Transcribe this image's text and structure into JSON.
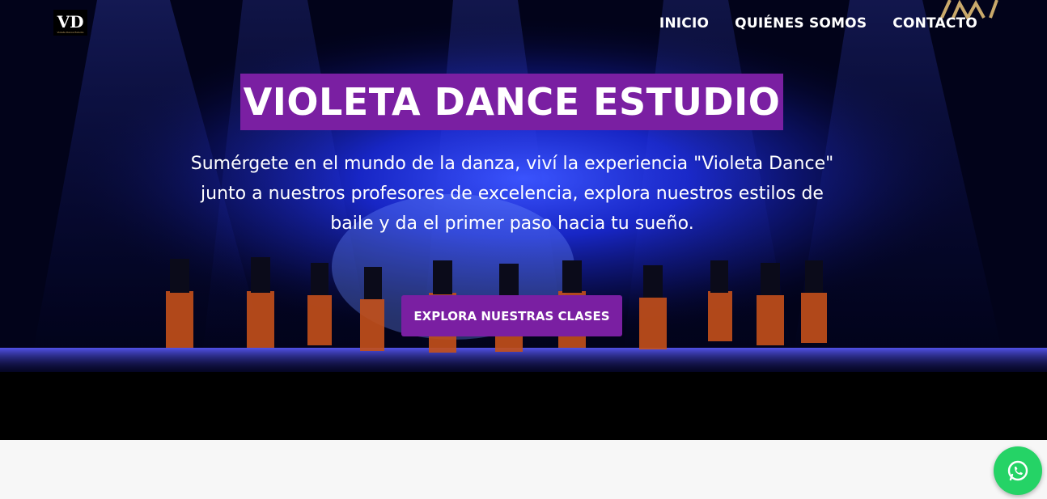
{
  "brand": {
    "logo_text": "VD",
    "logo_tagline": "Violeta Dance Estudio"
  },
  "nav": {
    "items": [
      {
        "label": "INICIO"
      },
      {
        "label": "QUIÉNES SOMOS"
      },
      {
        "label": "CONTACTO"
      }
    ]
  },
  "hero": {
    "title": "VIOLETA DANCE ESTUDIO",
    "subtitle": "Sumérgete en el mundo de la danza, viví la experiencia \"Violeta Dance\" junto a nuestros profesores de excelencia, explora nuestros estilos de baile y da el primer paso hacia tu sueño.",
    "cta_label": "EXPLORA NUESTRAS CLASES"
  },
  "colors": {
    "accent": "#7a1fa2",
    "whatsapp": "#25d366",
    "stage_blue": "#1a2cff"
  },
  "icons": {
    "whatsapp": "whatsapp-icon"
  }
}
